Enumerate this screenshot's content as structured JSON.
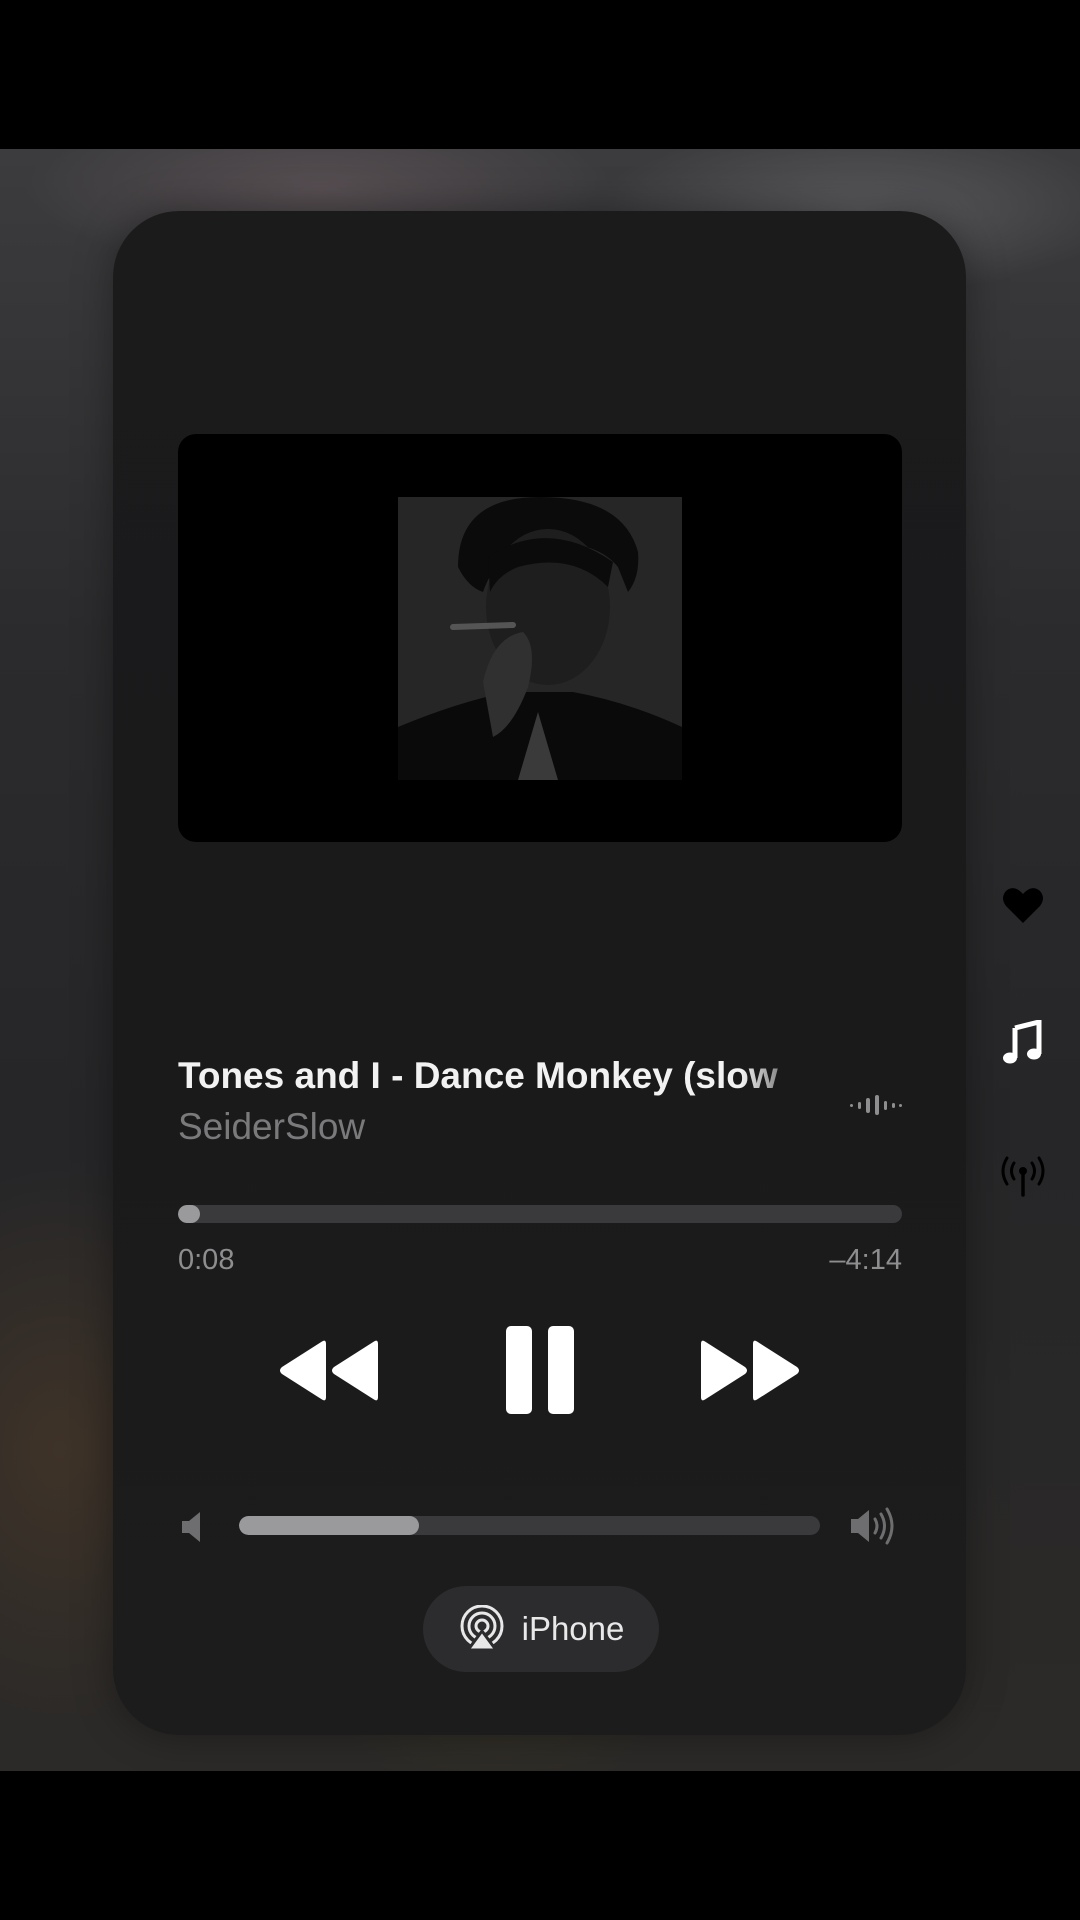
{
  "now_playing": {
    "title": "Tones and I - Dance Monkey (slow",
    "artist": "SeiderSlow",
    "elapsed": "0:08",
    "remaining": "–4:14",
    "progress_fraction": 0.03,
    "volume_fraction": 0.31
  },
  "output": {
    "device_label": "iPhone"
  },
  "icons": {
    "rewind": "rewind-icon",
    "pause": "pause-icon",
    "forward": "fast-forward-icon",
    "volume_low": "speaker-low-icon",
    "volume_high": "speaker-high-icon",
    "airplay": "airplay-icon",
    "waveform": "waveform-icon",
    "heart": "heart-icon",
    "music": "music-note-icon",
    "broadcast": "broadcast-antenna-icon"
  },
  "colors": {
    "card_bg": "#1b1b1c",
    "track": "#3a3a3c",
    "fill": "#9a9a9c",
    "primary_text": "#f2f2f2",
    "secondary_text": "#7a7a7c"
  }
}
